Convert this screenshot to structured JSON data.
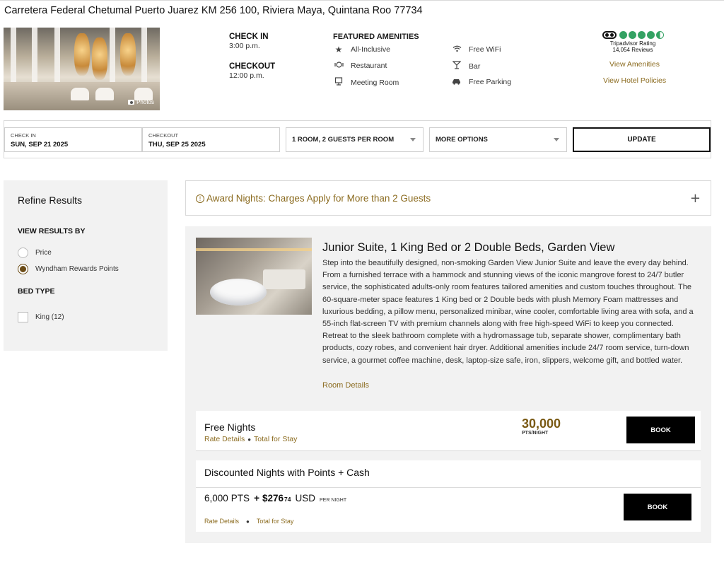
{
  "hotel": {
    "address": "Carretera Federal Chetumal Puerto Juarez KM 256 100, Riviera Maya, Quintana Roo 77734",
    "photos_label": "Photos",
    "check_in_label": "CHECK IN",
    "check_in_time": "3:00 p.m.",
    "checkout_label": "CHECKOUT",
    "checkout_time": "12:00 p.m.",
    "amenities_title": "FEATURED AMENITIES",
    "amenities": [
      {
        "label": "All-Inclusive",
        "icon": "star-icon"
      },
      {
        "label": "Free WiFi",
        "icon": "wifi-icon"
      },
      {
        "label": "Restaurant",
        "icon": "restaurant-icon"
      },
      {
        "label": "Bar",
        "icon": "bar-icon"
      },
      {
        "label": "Meeting Room",
        "icon": "meeting-room-icon"
      },
      {
        "label": "Free Parking",
        "icon": "parking-icon"
      }
    ],
    "tripadvisor": {
      "rating": 4.5,
      "rating_label": "Tripadvisor Rating",
      "reviews": "14,054 Reviews"
    },
    "view_amenities": "View Amenities",
    "view_policies": "View Hotel Policies"
  },
  "search": {
    "check_in_label": "CHECK IN",
    "check_in_value": "SUN, SEP 21 2025",
    "checkout_label": "CHECKOUT",
    "checkout_value": "THU, SEP 25 2025",
    "rooms_guests": "1 ROOM, 2 GUESTS PER ROOM",
    "more_options": "MORE OPTIONS",
    "update_label": "UPDATE"
  },
  "sidebar": {
    "title": "Refine Results",
    "view_by_heading": "VIEW RESULTS BY",
    "view_by_options": [
      {
        "label": "Price",
        "selected": false
      },
      {
        "label": "Wyndham Rewards Points",
        "selected": true
      }
    ],
    "bed_type_heading": "BED TYPE",
    "bed_types": [
      {
        "label": "King (12)",
        "checked": false
      }
    ]
  },
  "award_notice": {
    "text": "Award Nights: Charges Apply for More than 2 Guests",
    "expand": "+"
  },
  "room": {
    "title": "Junior Suite, 1 King Bed or 2 Double Beds, Garden View",
    "description": "Step into the beautifully designed, non-smoking Garden View Junior Suite and leave the every day behind. From a furnished terrace with a hammock and stunning views of the iconic mangrove forest to 24/7 butler service, the sophisticated adults-only room features tailored amenities and custom touches throughout. The 60-square-meter space features 1 King bed or 2 Double beds with plush Memory Foam mattresses and luxurious bedding, a pillow menu, personalized minibar, wine cooler, comfortable living area with sofa, and a 55-inch flat-screen TV with premium channels along with free high-speed WiFi to keep you connected. Retreat to the sleek bathroom complete with a hydromassage tub, separate shower, complimentary bath products, cozy robes, and convenient hair dryer. Additional amenities include 24/7 room service, turn-down service, a gourmet coffee machine, desk, laptop-size safe, iron, slippers, welcome gift, and bottled water.",
    "details_link": "Room Details"
  },
  "rates": [
    {
      "title": "Free Nights",
      "rate_details": "Rate Details",
      "total_for_stay": "Total for Stay",
      "points": "30,000",
      "points_unit": "PTS/NIGHT",
      "book": "BOOK"
    },
    {
      "title": "Discounted Nights with Points + Cash",
      "points": "6,000",
      "points_suffix": "PTS",
      "plus": "+",
      "cash_main": "$276",
      "cash_cents": "74",
      "currency": "USD",
      "per_night": "PER NIGHT",
      "rate_details": "Rate Details",
      "total_for_stay": "Total for Stay",
      "book": "BOOK"
    }
  ],
  "colors": {
    "accent_gold": "#8b6b1f",
    "points_gold": "#7a5a14",
    "tripadvisor_green": "#34a263",
    "panel_gray": "#f2f2f2"
  }
}
